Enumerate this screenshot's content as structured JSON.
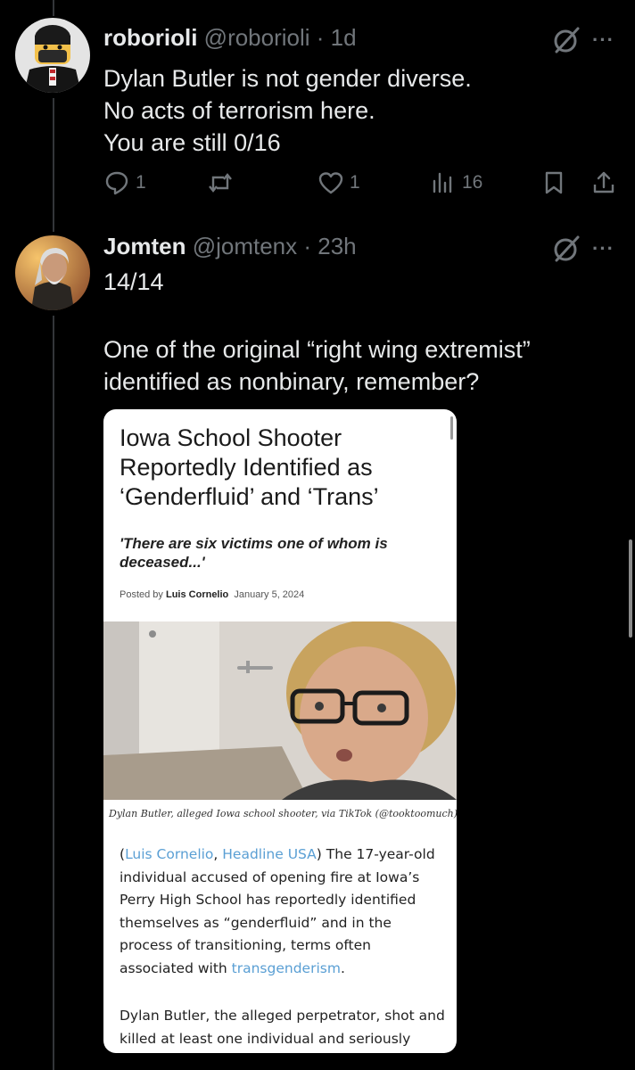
{
  "posts": [
    {
      "name": "roborioli",
      "handle": "@roborioli",
      "time": "1d",
      "text_lines": [
        "Dylan Butler is not gender diverse.",
        "No acts of terrorism here.",
        "You are still 0/16"
      ],
      "replies": "1",
      "reposts": "",
      "likes": "1",
      "views": "16"
    },
    {
      "name": "Jomten",
      "handle": "@jomtenx",
      "time": "23h",
      "text_lines": [
        "14/14",
        "",
        "One of the original “right wing extremist”",
        "identified as nonbinary, remember?"
      ]
    }
  ],
  "article": {
    "title": "Iowa School Shooter Reportedly Identified as ‘Genderfluid’ and ‘Trans’",
    "subtitle": "'There are six victims one of whom is deceased...'",
    "posted_prefix": "Posted by",
    "author": "Luis Cornelio",
    "date": "January 5, 2024",
    "caption": "Dylan Butler, alleged Iowa school shooter, via TikTok (@tooktoomuch)",
    "para1_open": "(",
    "para1_author_link": "Luis Cornelio",
    "para1_sep": ", ",
    "para1_outlet_link": "Headline USA",
    "para1_text": ") The 17-year-old individual accused of opening fire at Iowa’s Perry High School has reportedly identified themselves as “genderfluid” and in the process of transitioning, terms often associated with ",
    "para1_end_link": "transgenderism",
    "para1_end": ".",
    "para2": "Dylan Butler, the alleged perpetrator, shot and killed at least one individual and seriously"
  },
  "icons": {
    "reply": "reply-icon",
    "repost": "repost-icon",
    "like": "heart-icon",
    "views": "views-icon",
    "bookmark": "bookmark-icon",
    "share": "share-icon",
    "grok": "grok-icon",
    "more": "more-icon"
  },
  "colors": {
    "background": "#000000",
    "text": "#e7e9ea",
    "muted": "#71767b",
    "link": "#5a9fd4"
  }
}
